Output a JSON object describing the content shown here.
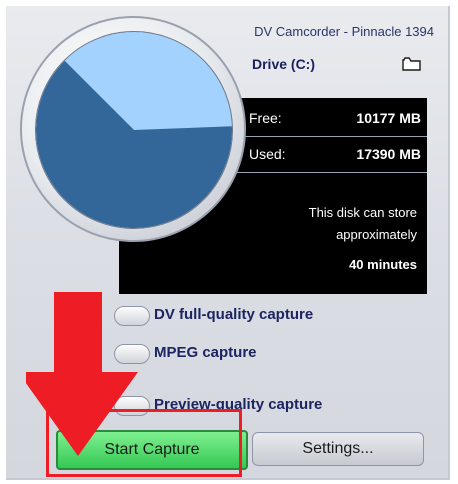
{
  "device": {
    "title": "DV Camcorder - Pinnacle 1394"
  },
  "drive": {
    "label": "Drive (C:)",
    "folder_icon": "folder-icon"
  },
  "storage": {
    "free_label": "Free:",
    "free_value": "10177 MB",
    "used_label": "Used:",
    "used_value": "17390 MB",
    "free_fraction": 0.369,
    "gauge_colors": {
      "free": "#a3d2ff",
      "used": "#336699"
    }
  },
  "message": {
    "line1": "This disk can store",
    "line2": "approximately",
    "minutes": "40 minutes"
  },
  "options": [
    {
      "label": "DV full-quality capture",
      "selected": false
    },
    {
      "label": "MPEG capture",
      "selected": false
    },
    {
      "label": "Preview-quality capture",
      "selected": false
    }
  ],
  "buttons": {
    "start": "Start Capture",
    "settings": "Settings..."
  },
  "annotation": {
    "arrow_color": "#ee1c24",
    "box_color": "#ee1c24"
  }
}
